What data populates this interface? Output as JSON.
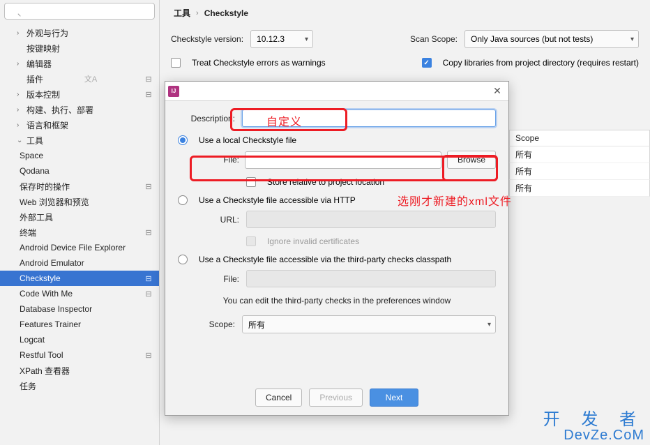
{
  "sidebar": {
    "search_placeholder": "",
    "items": [
      {
        "label": "外观与行为",
        "arrow": "›",
        "dirty": false,
        "lang": false
      },
      {
        "label": "按键映射",
        "arrow": "",
        "dirty": false,
        "lang": false
      },
      {
        "label": "编辑器",
        "arrow": "›",
        "dirty": false,
        "lang": false
      },
      {
        "label": "插件",
        "arrow": "",
        "dirty": true,
        "lang": true
      },
      {
        "label": "版本控制",
        "arrow": "›",
        "dirty": true,
        "lang": false
      },
      {
        "label": "构建、执行、部署",
        "arrow": "›",
        "dirty": false,
        "lang": false
      },
      {
        "label": "语言和框架",
        "arrow": "›",
        "dirty": false,
        "lang": false
      },
      {
        "label": "工具",
        "arrow": "⌄",
        "dirty": false,
        "lang": false
      }
    ],
    "tools_children": [
      "Space",
      "Qodana",
      "保存时的操作",
      "Web 浏览器和预览",
      "外部工具",
      "终端",
      "Android Device File Explorer",
      "Android Emulator",
      "Checkstyle",
      "Code With Me",
      "Database Inspector",
      "Features Trainer",
      "Logcat",
      "Restful Tool",
      "XPath 查看器",
      "任务"
    ],
    "tools_dirty_idx": [
      2,
      5,
      8,
      9,
      13
    ],
    "selected": "Checkstyle",
    "lang_badge": "文A"
  },
  "breadcrumb": {
    "root": "工具",
    "sep": "›",
    "leaf": "Checkstyle"
  },
  "settings": {
    "version_label": "Checkstyle version:",
    "version_value": "10.12.3",
    "scan_label": "Scan Scope:",
    "scan_value": "Only Java sources (but not tests)",
    "warnings_label": "Treat Checkstyle errors as warnings",
    "copylibs_label": "Copy libraries from project directory (requires restart)",
    "scope_header": "Scope",
    "scope_rows": [
      "所有",
      "所有",
      "所有"
    ]
  },
  "dialog": {
    "desc_label": "Description:",
    "desc_value": "",
    "opt_local": "Use a local Checkstyle file",
    "file_label": "File:",
    "file_value": "",
    "browse": "Browse",
    "store_relative": "Store relative to project location",
    "opt_http": "Use a Checkstyle file accessible via HTTP",
    "url_label": "URL:",
    "ignore_cert": "Ignore invalid certificates",
    "opt_classpath": "Use a Checkstyle file accessible via the third-party checks classpath",
    "file2_label": "File:",
    "hint": "You can edit the third-party checks in the preferences window",
    "scope_label": "Scope:",
    "scope_value": "所有",
    "cancel": "Cancel",
    "previous": "Previous",
    "next": "Next"
  },
  "annotations": {
    "custom": "自定义",
    "choose_xml": "选刚才新建的xml文件"
  },
  "watermark": {
    "l1": "开 发 者",
    "l2": "DevZe.CoM"
  }
}
